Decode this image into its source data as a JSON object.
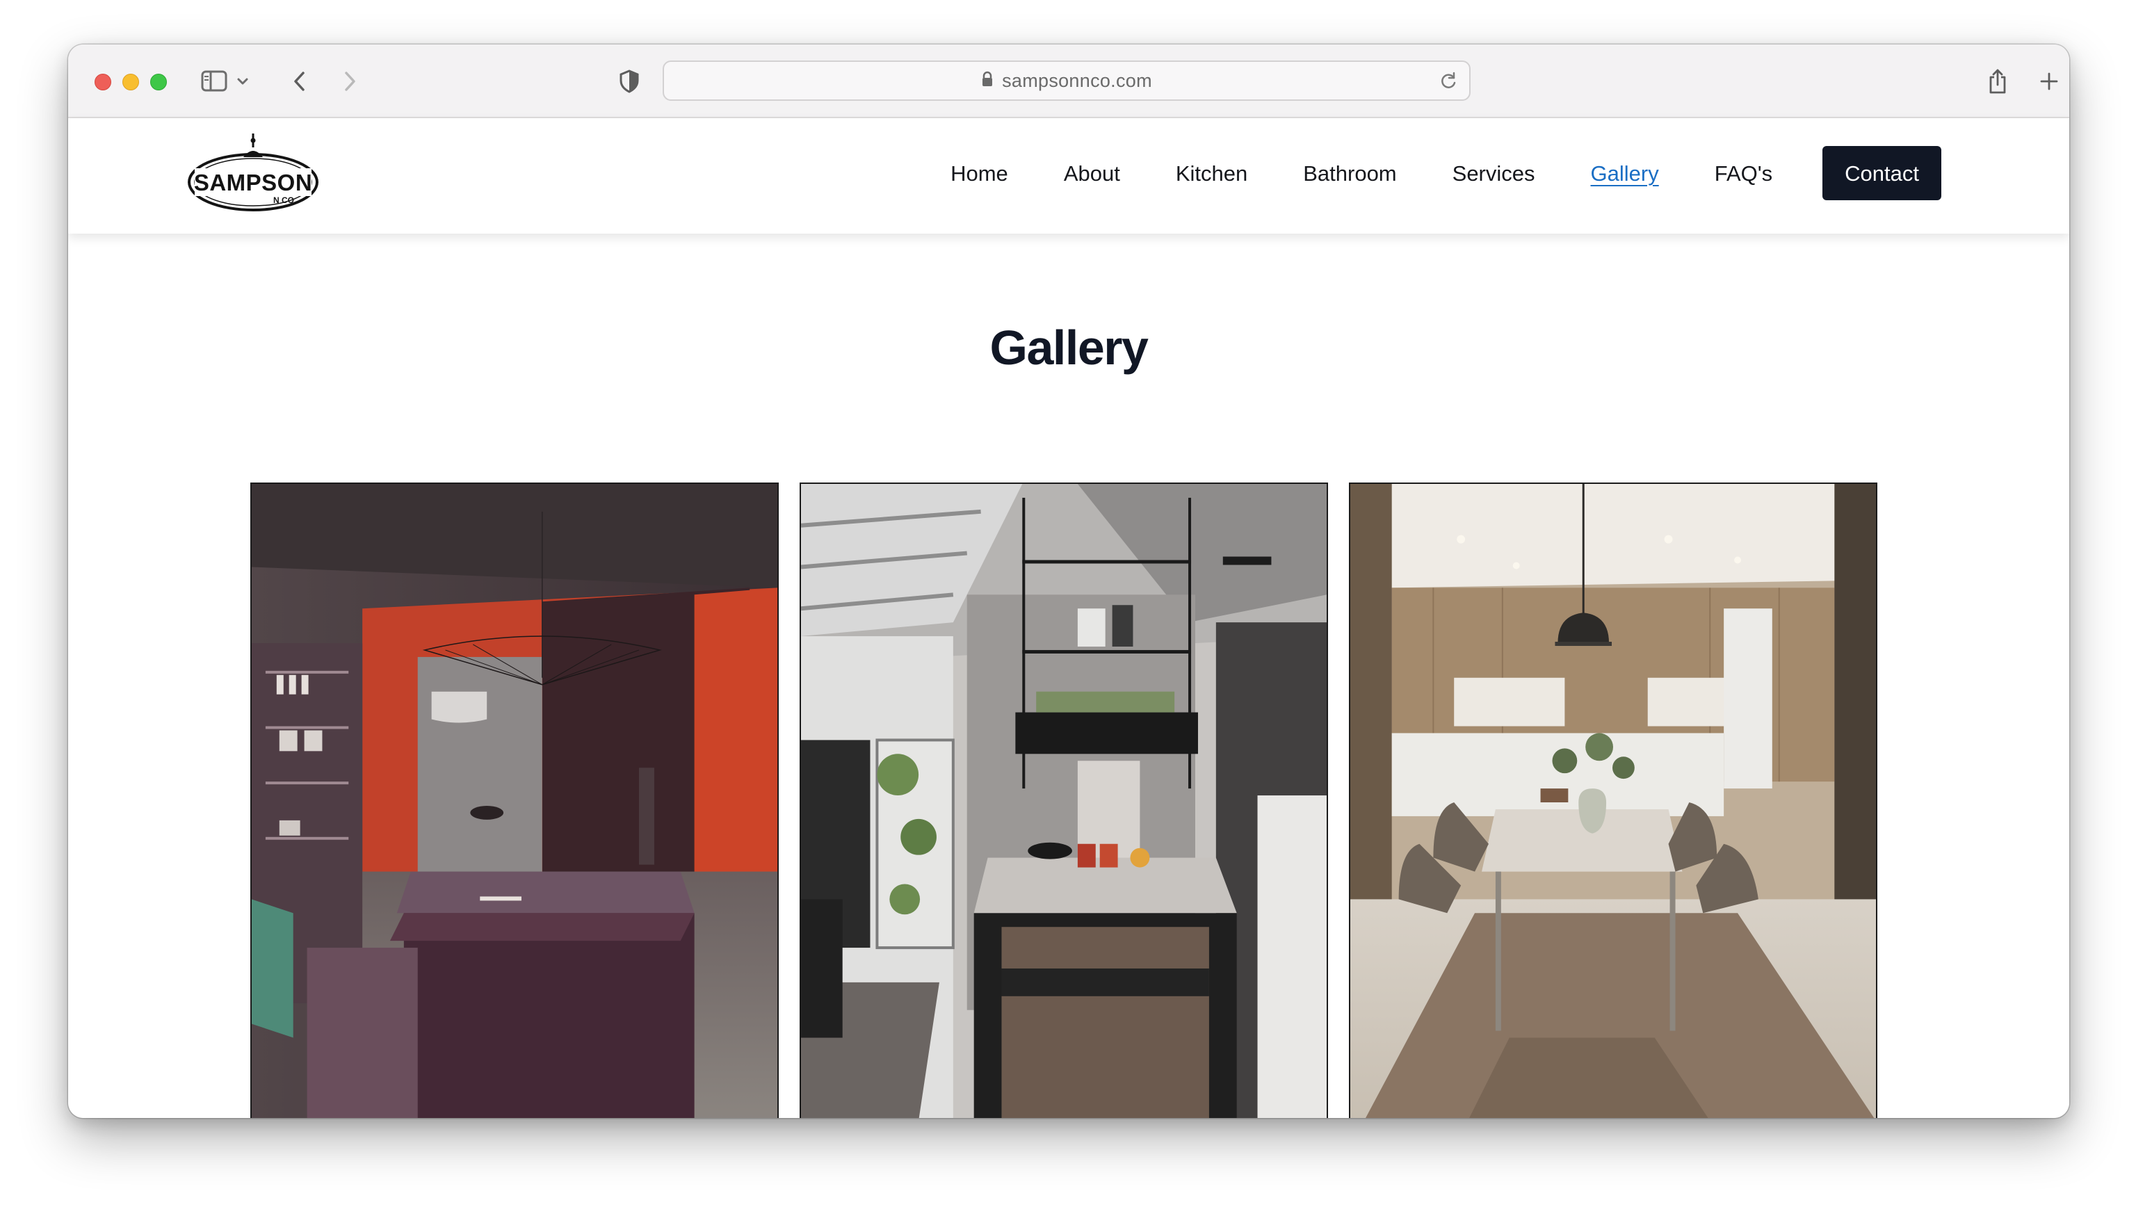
{
  "browser": {
    "url": "sampsonnco.com",
    "icons": [
      "sidebar-icon",
      "chevron-down-icon",
      "back-icon",
      "forward-icon",
      "shield-icon",
      "lock-icon",
      "reload-icon",
      "share-icon",
      "new-tab-icon",
      "tab-overview-icon"
    ],
    "traffic_colors": {
      "close": "#ee5f58",
      "minimize": "#f8be2f",
      "maximize": "#3ec747"
    }
  },
  "site": {
    "logo": {
      "name": "SAMPSON",
      "suffix": "N CO"
    },
    "nav": {
      "items": [
        {
          "label": "Home",
          "active": false
        },
        {
          "label": "About",
          "active": false
        },
        {
          "label": "Kitchen",
          "active": false
        },
        {
          "label": "Bathroom",
          "active": false
        },
        {
          "label": "Services",
          "active": false
        },
        {
          "label": "Gallery",
          "active": true
        },
        {
          "label": "FAQ's",
          "active": false
        }
      ],
      "contact_label": "Contact"
    },
    "colors": {
      "active_link": "#1a6ec4",
      "button_bg": "#111725",
      "title": "#111725"
    }
  },
  "page": {
    "title": "Gallery",
    "gallery": [
      {
        "id": "red-accent-kitchen"
      },
      {
        "id": "industrial-island-kitchen"
      },
      {
        "id": "wood-dining-kitchen"
      }
    ]
  }
}
